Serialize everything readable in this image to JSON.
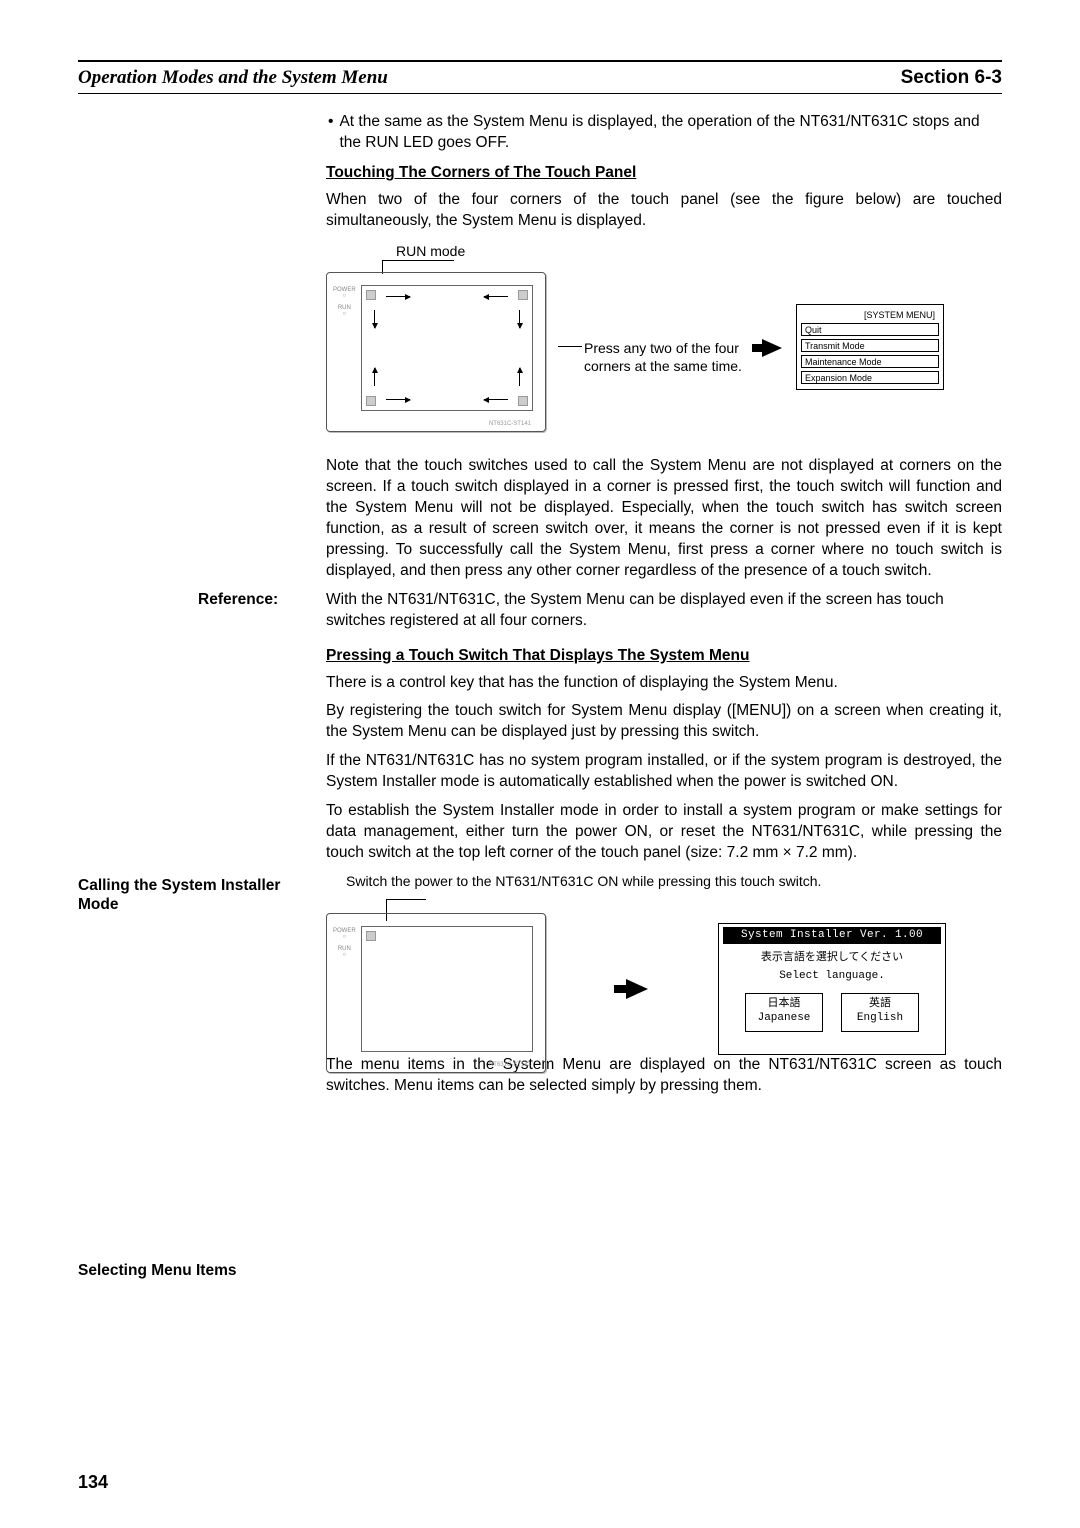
{
  "header": {
    "left": "Operation Modes and the System Menu",
    "right": "Section 6-3"
  },
  "bullet1": "At the same as the System Menu is displayed, the operation of the NT631/NT631C stops and the RUN LED goes OFF.",
  "sub1": "Touching The Corners of The Touch Panel",
  "p1": "When two of the four corners of the touch panel (see the figure below) are touched simultaneously, the System Menu is displayed.",
  "fig1": {
    "run_mode": "RUN mode",
    "press_l1": "Press any two of the four",
    "press_l2": "corners at the same time.",
    "sysmenu_title": "[SYSTEM MENU]",
    "sysmenu_items": [
      "Quit",
      "Transmit Mode",
      "Maintenance Mode",
      "Expansion Mode"
    ],
    "dev_power": "POWER",
    "dev_run": "RUN"
  },
  "p2": "Note that the touch switches used to call the System Menu are not displayed at corners on the screen. If a touch switch displayed in a corner is pressed first, the touch switch will function and the System Menu will not be displayed. Especially, when the touch switch has switch screen function, as a result of screen switch over, it means the corner is not pressed even if it is kept pressing. To successfully call the System Menu, first press a corner where no touch switch is displayed, and then press any other corner regardless of the presence of a touch switch.",
  "reference_label": "Reference:",
  "reference_body": "With the NT631/NT631C, the System Menu can be displayed even if the screen has touch switches registered at all four corners.",
  "sub2": "Pressing a Touch Switch That Displays The System Menu",
  "p3": "There is a control key that has the function of displaying the System Menu.",
  "p4": "By registering the touch switch for System Menu display ([MENU]) on a screen when creating it, the System Menu can be displayed just by pressing this switch.",
  "side1": "Calling the System Installer Mode",
  "p5": "If the NT631/NT631C has no system program installed, or if the system program is destroyed, the System Installer mode is automatically established when the power is switched ON.",
  "p6": "To establish the System Installer mode in order to install a system program or make settings for data management, either turn the power ON, or reset the NT631/NT631C, while pressing the touch switch at the top left corner of the touch panel (size: 7.2 mm × 7.2 mm).",
  "fig2_caption": "Switch the power to the NT631/NT631C ON while pressing this touch switch.",
  "fig2": {
    "title": "System Installer  Ver. 1.00",
    "jp": "表示言語を選択してください",
    "en": "Select language.",
    "lang1_jp": "日本語",
    "lang1_en": "Japanese",
    "lang2_jp": "英語",
    "lang2_en": "English"
  },
  "side2": "Selecting Menu Items",
  "p7": "The menu items in the System Menu are displayed on the NT631/NT631C screen as touch switches. Menu items can be selected simply by pressing them.",
  "page_number": "134"
}
